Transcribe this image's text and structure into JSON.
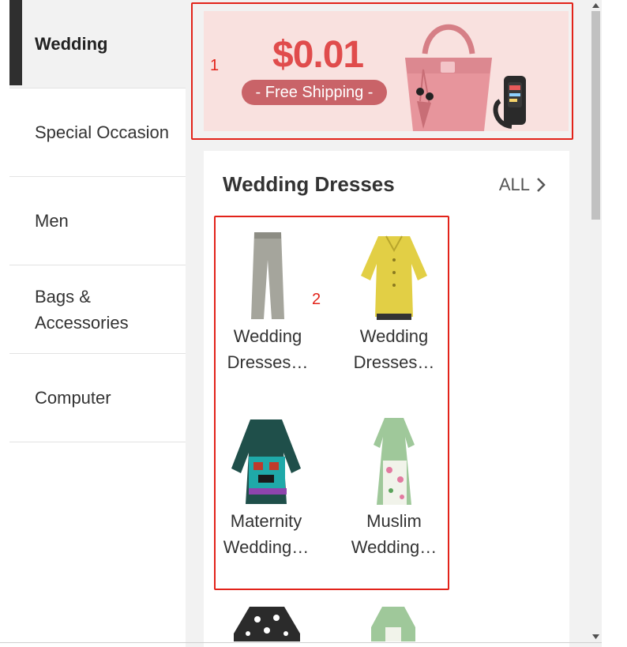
{
  "sidebar": {
    "items": [
      {
        "label": "Wedding",
        "active": true
      },
      {
        "label": "Special Occasion",
        "active": false
      },
      {
        "label": "Men",
        "active": false
      },
      {
        "label": "Bags & Accessories",
        "active": false
      },
      {
        "label": "Computer",
        "active": false
      }
    ]
  },
  "banner": {
    "price": "$0.01",
    "pill": "- Free Shipping -"
  },
  "annotations": {
    "banner_number": "1",
    "grid_number": "2"
  },
  "section": {
    "title": "Wedding Dresses",
    "all_label": "ALL"
  },
  "products": [
    {
      "line1": "Wedding",
      "line2": "Dresses…",
      "icon": "gray-trousers-image"
    },
    {
      "line1": "Wedding",
      "line2": "Dresses…",
      "icon": "yellow-blouse-image"
    },
    {
      "line1": "Maternity",
      "line2": "Wedding…",
      "icon": "patterned-tunic-image"
    },
    {
      "line1": "Muslim",
      "line2": "Wedding…",
      "icon": "floral-dress-image"
    }
  ],
  "colors": {
    "accent_red": "#e2231a",
    "banner_bg": "#f9e1df",
    "banner_price": "#e04c4c",
    "pill_bg": "#c96368",
    "active_bar": "#2f2f2f",
    "panel_bg": "#f2f2f2"
  }
}
